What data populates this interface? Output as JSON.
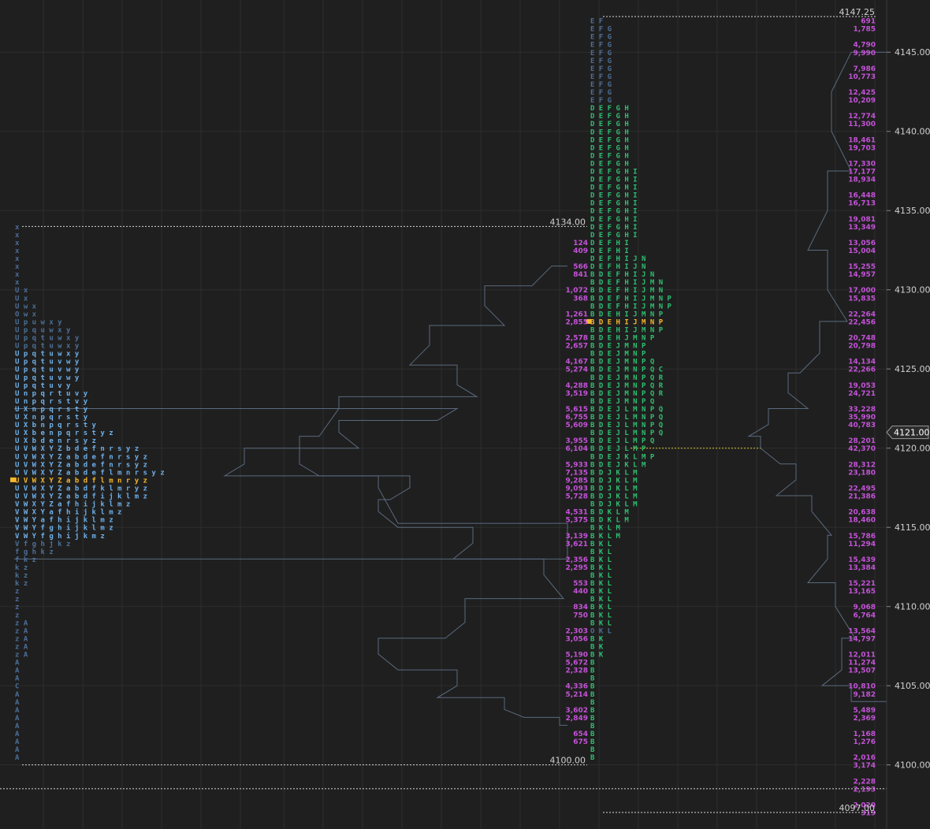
{
  "colors": {
    "background": "#1f1f1f",
    "grid": "#2e2e2e",
    "tpo_blue": "#5b8fc9",
    "tpo_blue_bright": "#6fb0e8",
    "tpo_green": "#2fbf71",
    "tpo_dim": "#4d6f97",
    "volume_text": "#c453d8",
    "poc": "#f5b82e",
    "outline": "#5a6a7e",
    "axis_text": "#d0d0d0",
    "ref_line": "#d8d8d8",
    "yellow_line": "#d6c630"
  },
  "chart_data": {
    "type": "market-profile",
    "price_axis": {
      "ylim": [
        4096.75,
        4147.5
      ],
      "ticks": [
        4145.0,
        4140.0,
        4135.0,
        4130.0,
        4125.0,
        4120.0,
        4115.0,
        4110.0,
        4105.0,
        4100.0
      ],
      "tick_labels": [
        "4145.00",
        "4140.00",
        "4135.00",
        "4130.00",
        "4125.00",
        "4120.00",
        "4115.00",
        "4110.00",
        "4105.00",
        "4100.00"
      ],
      "tick_size": 0.5,
      "current_price": 4121.0,
      "current_price_label": "4121.00"
    },
    "reference_lines": [
      {
        "price": 4147.25,
        "label": "4147.25",
        "profile": "right"
      },
      {
        "price": 4134.0,
        "label": "4134.00",
        "profile": "middle"
      },
      {
        "price": 4100.0,
        "label": "4100.00",
        "profile": "left"
      },
      {
        "price": 4098.5,
        "label": "",
        "profile": "full"
      },
      {
        "price": 4097.0,
        "label": "4097.00",
        "profile": "right"
      }
    ],
    "yellow_line": {
      "price": 4120.0
    },
    "profiles": [
      {
        "name": "left",
        "top": 4134.0,
        "poc": 4118.0,
        "rows": [
          "x",
          "x",
          "x",
          "x",
          "x",
          "x",
          "x",
          "x",
          "U x",
          "U x",
          "U w x",
          "O w x",
          "U p u w x y",
          "U p q u w x y",
          "U p q t u w x y",
          "U p q t u w x y",
          "U p q t u w x y",
          "U p q t u v w y",
          "U p q t u v w y",
          "U p q t u v w y",
          "U p q t u v y",
          "U n p q r t u v y",
          "U n p q r s t v y",
          "U X n p q r s t y",
          "U X n p q r s t y",
          "U X b n p q r s t y",
          "U X b e n p q r s t y z",
          "U X b d e n r s y z",
          "U V W X Y Z b d e f n r s y z",
          "U V W X Y Z a b d e f n r s y z",
          "U V W X Y Z a b d e f n r s y z",
          "U V W X Y Z a b d e f l m n r s y z",
          "U V W X Y Z a b d f l m n r y z",
          "U V W X Y Z a b d f k l m r y z",
          "U V W X Y Z a b d f i j k l m z",
          "V W X Y Z a f h i j k l m z",
          "V W X Y a f h i j k l m z",
          "V W Y a f h i j k l m z",
          "V W Y f g h i j k l m z",
          "V W Y f g h i j k m z",
          "V f g h j k z",
          "f g h k z",
          "f k z",
          "k z",
          "k z",
          "k z",
          "z",
          "z",
          "z",
          "z",
          "z A",
          "z A",
          "z A",
          "z A",
          "z A",
          "A",
          "A",
          "A",
          "C",
          "A",
          "A",
          "A",
          "A",
          "A",
          "A",
          "A",
          "A",
          "A"
        ],
        "outline": [
          [
            4122.5,
            580
          ],
          [
            4121.0,
            430
          ],
          [
            4119.0,
            310
          ],
          [
            4117.5,
            480
          ],
          [
            4113.0,
            720
          ]
        ]
      },
      {
        "name": "middle",
        "top": 4147.0,
        "poc": 4128.0,
        "rows": [
          "E F",
          "E F G",
          "E F G",
          "E F G",
          "E F G",
          "E F G",
          "E F G",
          "E F G",
          "E F G",
          "E F G",
          "E F G",
          "D E F G H",
          "D E F G H",
          "D E F G H",
          "D E F G H",
          "D E F G H",
          "D E F G H",
          "D E F G H",
          "D E F G H",
          "D E F G H I",
          "D E F G H I",
          "D E F G H I",
          "D E F G H I",
          "D E F G H I",
          "D E F G H I",
          "D E F G H I",
          "D E F G H I",
          "D E F G H I",
          "D E F H I",
          "D E F H I",
          "D E F H I J N",
          "D E F H I J N",
          "B D E F H I J N",
          "B D E F H I J M N",
          "B D E F H I J M N",
          "B D E F H I J M N P",
          "B D E F H I J M N P",
          "B D E H I J M N P",
          "B D E H I J M N P",
          "B D E H I J M N P",
          "B D E H J M N P",
          "B D E J M N P",
          "B D E J M N P",
          "B D E J M N P Q",
          "B D E J M N P Q C",
          "B D E J M N P Q R",
          "B D E J M N P Q R",
          "B D E J M N P Q R",
          "B D E J M N P Q",
          "B D E J L M N P Q",
          "B D E J L M N P Q",
          "B D E J L M N P Q",
          "B D E J L M N P Q",
          "B D E J L M P Q",
          "B D E J L M P",
          "B D E J K L M P",
          "B D E J K L M",
          "B D J K L M",
          "B D J K L M",
          "B D J K L M",
          "B D J K L M",
          "B D J K L M",
          "B D K L M",
          "B D K L M",
          "B K L M",
          "B K L M",
          "B K L",
          "B K L",
          "B K L",
          "B K L",
          "B K L",
          "B K L",
          "B K L",
          "B K L",
          "B K L",
          "B K L",
          "B K L",
          "O K L",
          "B K",
          "B K",
          "B K",
          "B",
          "B",
          "B",
          "B",
          "B",
          "B",
          "B",
          "B",
          "B",
          "B",
          "B",
          "B",
          "B"
        ],
        "volume_labels": [
          {
            "price": 4133.0,
            "value": "124"
          },
          {
            "price": 4132.5,
            "value": "409"
          },
          {
            "price": 4131.5,
            "value": "566"
          },
          {
            "price": 4131.0,
            "value": "841"
          },
          {
            "price": 4130.0,
            "value": "1,072"
          },
          {
            "price": 4129.5,
            "value": "368"
          },
          {
            "price": 4128.5,
            "value": "1,261"
          },
          {
            "price": 4128.0,
            "value": "2,855"
          },
          {
            "price": 4127.0,
            "value": "2,578"
          },
          {
            "price": 4126.5,
            "value": "2,657"
          },
          {
            "price": 4125.5,
            "value": "4,167"
          },
          {
            "price": 4125.0,
            "value": "5,274"
          },
          {
            "price": 4124.0,
            "value": "4,288"
          },
          {
            "price": 4123.5,
            "value": "3,519"
          },
          {
            "price": 4122.5,
            "value": "5,615"
          },
          {
            "price": 4122.0,
            "value": "6,755"
          },
          {
            "price": 4121.5,
            "value": "5,609"
          },
          {
            "price": 4120.5,
            "value": "3,955"
          },
          {
            "price": 4120.0,
            "value": "6,104"
          },
          {
            "price": 4119.0,
            "value": "5,933"
          },
          {
            "price": 4118.5,
            "value": "7,135"
          },
          {
            "price": 4118.0,
            "value": "9,285"
          },
          {
            "price": 4117.5,
            "value": "9,093"
          },
          {
            "price": 4117.0,
            "value": "5,728"
          },
          {
            "price": 4116.0,
            "value": "4,531"
          },
          {
            "price": 4115.5,
            "value": "5,375"
          },
          {
            "price": 4114.5,
            "value": "3,139"
          },
          {
            "price": 4114.0,
            "value": "3,621"
          },
          {
            "price": 4113.0,
            "value": "2,356"
          },
          {
            "price": 4112.5,
            "value": "2,295"
          },
          {
            "price": 4111.5,
            "value": "553"
          },
          {
            "price": 4111.0,
            "value": "440"
          },
          {
            "price": 4110.0,
            "value": "834"
          },
          {
            "price": 4109.5,
            "value": "750"
          },
          {
            "price": 4108.5,
            "value": "2,303"
          },
          {
            "price": 4108.0,
            "value": "3,056"
          },
          {
            "price": 4107.0,
            "value": "5,190"
          },
          {
            "price": 4106.5,
            "value": "5,672"
          },
          {
            "price": 4106.0,
            "value": "2,328"
          },
          {
            "price": 4105.0,
            "value": "4,336"
          },
          {
            "price": 4104.5,
            "value": "5,214"
          },
          {
            "price": 4103.5,
            "value": "3,602"
          },
          {
            "price": 4103.0,
            "value": "2,849"
          },
          {
            "price": 4102.0,
            "value": "654"
          },
          {
            "price": 4101.5,
            "value": "675"
          }
        ],
        "outline": [
          [
            4131.5,
            700
          ],
          [
            4129.0,
            615
          ],
          [
            4126.5,
            545
          ],
          [
            4124.0,
            580
          ],
          [
            4122.5,
            430
          ],
          [
            4119.0,
            380
          ],
          [
            4117.5,
            520
          ],
          [
            4116.0,
            480
          ],
          [
            4114.0,
            600
          ],
          [
            4112.0,
            690
          ],
          [
            4109.0,
            590
          ],
          [
            4107.0,
            480
          ],
          [
            4105.0,
            580
          ],
          [
            4103.5,
            640
          ],
          [
            4102.5,
            710
          ]
        ]
      },
      {
        "name": "right",
        "top": 4147.0,
        "poc": 4120.0,
        "volume_labels": [
          {
            "price": 4147.0,
            "value": "691"
          },
          {
            "price": 4146.5,
            "value": "1,785"
          },
          {
            "price": 4145.5,
            "value": "4,790"
          },
          {
            "price": 4145.0,
            "value": "9,990"
          },
          {
            "price": 4144.0,
            "value": "7,986"
          },
          {
            "price": 4143.5,
            "value": "10,773"
          },
          {
            "price": 4142.5,
            "value": "12,425"
          },
          {
            "price": 4142.0,
            "value": "10,209"
          },
          {
            "price": 4141.0,
            "value": "12,774"
          },
          {
            "price": 4140.5,
            "value": "11,300"
          },
          {
            "price": 4139.5,
            "value": "18,461"
          },
          {
            "price": 4139.0,
            "value": "19,703"
          },
          {
            "price": 4138.0,
            "value": "17,330"
          },
          {
            "price": 4137.5,
            "value": "17,177"
          },
          {
            "price": 4137.0,
            "value": "18,934"
          },
          {
            "price": 4136.0,
            "value": "16,448"
          },
          {
            "price": 4135.5,
            "value": "16,713"
          },
          {
            "price": 4134.5,
            "value": "19,081"
          },
          {
            "price": 4134.0,
            "value": "13,349"
          },
          {
            "price": 4133.0,
            "value": "13,056"
          },
          {
            "price": 4132.5,
            "value": "15,004"
          },
          {
            "price": 4131.5,
            "value": "15,255"
          },
          {
            "price": 4131.0,
            "value": "14,957"
          },
          {
            "price": 4130.0,
            "value": "17,000"
          },
          {
            "price": 4129.5,
            "value": "15,835"
          },
          {
            "price": 4128.5,
            "value": "22,264"
          },
          {
            "price": 4128.0,
            "value": "22,456"
          },
          {
            "price": 4127.0,
            "value": "20,748"
          },
          {
            "price": 4126.5,
            "value": "20,798"
          },
          {
            "price": 4125.5,
            "value": "14,134"
          },
          {
            "price": 4125.0,
            "value": "22,266"
          },
          {
            "price": 4124.0,
            "value": "19,053"
          },
          {
            "price": 4123.5,
            "value": "24,721"
          },
          {
            "price": 4122.5,
            "value": "33,228"
          },
          {
            "price": 4122.0,
            "value": "35,990"
          },
          {
            "price": 4121.5,
            "value": "40,783"
          },
          {
            "price": 4120.5,
            "value": "28,201"
          },
          {
            "price": 4120.0,
            "value": "42,370"
          },
          {
            "price": 4119.0,
            "value": "28,312"
          },
          {
            "price": 4118.5,
            "value": "23,180"
          },
          {
            "price": 4117.5,
            "value": "22,495"
          },
          {
            "price": 4117.0,
            "value": "21,386"
          },
          {
            "price": 4116.0,
            "value": "20,638"
          },
          {
            "price": 4115.5,
            "value": "18,460"
          },
          {
            "price": 4114.5,
            "value": "15,786"
          },
          {
            "price": 4114.0,
            "value": "11,294"
          },
          {
            "price": 4113.0,
            "value": "15,439"
          },
          {
            "price": 4112.5,
            "value": "13,384"
          },
          {
            "price": 4111.5,
            "value": "15,221"
          },
          {
            "price": 4111.0,
            "value": "13,165"
          },
          {
            "price": 4110.0,
            "value": "9,068"
          },
          {
            "price": 4109.5,
            "value": "6,764"
          },
          {
            "price": 4108.5,
            "value": "13,564"
          },
          {
            "price": 4108.0,
            "value": "14,797"
          },
          {
            "price": 4107.0,
            "value": "12,011"
          },
          {
            "price": 4106.5,
            "value": "11,274"
          },
          {
            "price": 4106.0,
            "value": "13,507"
          },
          {
            "price": 4105.0,
            "value": "10,810"
          },
          {
            "price": 4104.5,
            "value": "9,182"
          },
          {
            "price": 4103.5,
            "value": "5,489"
          },
          {
            "price": 4103.0,
            "value": "2,369"
          },
          {
            "price": 4102.0,
            "value": "1,168"
          },
          {
            "price": 4101.5,
            "value": "1,276"
          },
          {
            "price": 4100.5,
            "value": "2,016"
          },
          {
            "price": 4100.0,
            "value": "3,174"
          },
          {
            "price": 4099.0,
            "value": "2,228"
          },
          {
            "price": 4098.5,
            "value": "2,193"
          },
          {
            "price": 4097.5,
            "value": "2,020"
          },
          {
            "price": 4097.0,
            "value": "319"
          }
        ],
        "outline": [
          [
            4145.0,
            1080
          ],
          [
            4140.0,
            1055
          ],
          [
            4135.0,
            1050
          ],
          [
            4130.0,
            1050
          ],
          [
            4126.0,
            1040
          ],
          [
            4123.5,
            1000
          ],
          [
            4121.5,
            975
          ],
          [
            4120.0,
            965
          ],
          [
            4118.0,
            1010
          ],
          [
            4116.0,
            1030
          ],
          [
            4113.0,
            1050
          ],
          [
            4110.0,
            1060
          ],
          [
            4106.0,
            1068
          ],
          [
            4104.0,
            1080
          ]
        ]
      }
    ]
  }
}
